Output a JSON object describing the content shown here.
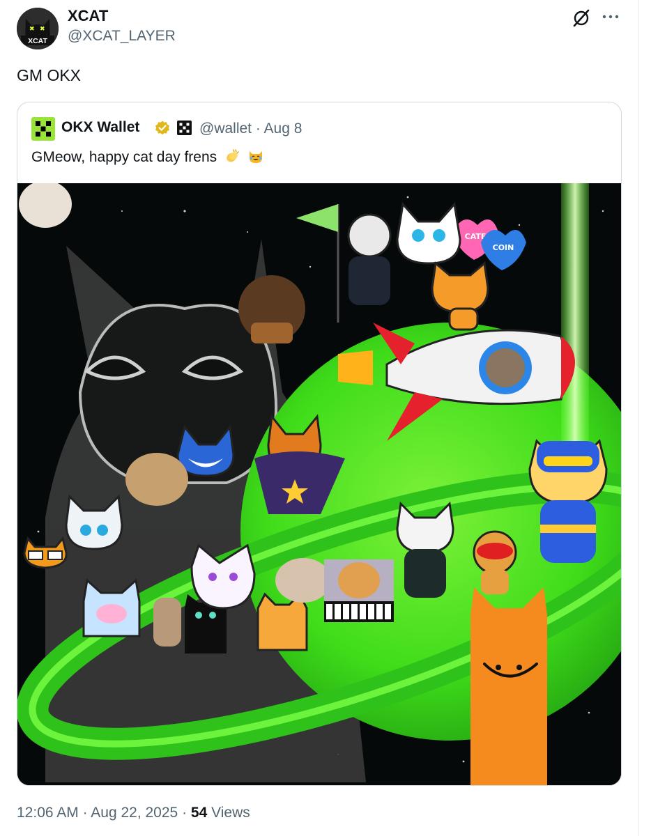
{
  "author": {
    "display_name": "XCAT",
    "handle": "@XCAT_LAYER",
    "avatar_text": "XCAT"
  },
  "tweet": {
    "text": "GM OKX"
  },
  "quoted": {
    "display_name": "OKX Wallet",
    "handle": "@wallet",
    "separator": "·",
    "date": "Aug 8",
    "text": "GMeow, happy cat day frens",
    "emojis": [
      "clapping-hands",
      "cat-tears-of-joy"
    ],
    "media_labels": [
      "CATE",
      "COIN"
    ]
  },
  "footer": {
    "time": "12:06 AM",
    "sep1": "·",
    "date": "Aug 22, 2025",
    "sep2": "·",
    "views_count": "54",
    "views_label": "Views"
  },
  "colors": {
    "name_text": "#0f1419",
    "secondary_text": "#536471",
    "card_border": "#cfd9de",
    "okx_green": "#9ae43a",
    "verified_gold": "#e2b719",
    "planet_green": "#3fdc1a",
    "space_bg": "#05090a"
  },
  "icons": {
    "grok": "grok-slash-icon",
    "more": "more-dots-icon",
    "verified": "verified-badge-icon",
    "affiliate": "okx-affiliate-icon"
  }
}
